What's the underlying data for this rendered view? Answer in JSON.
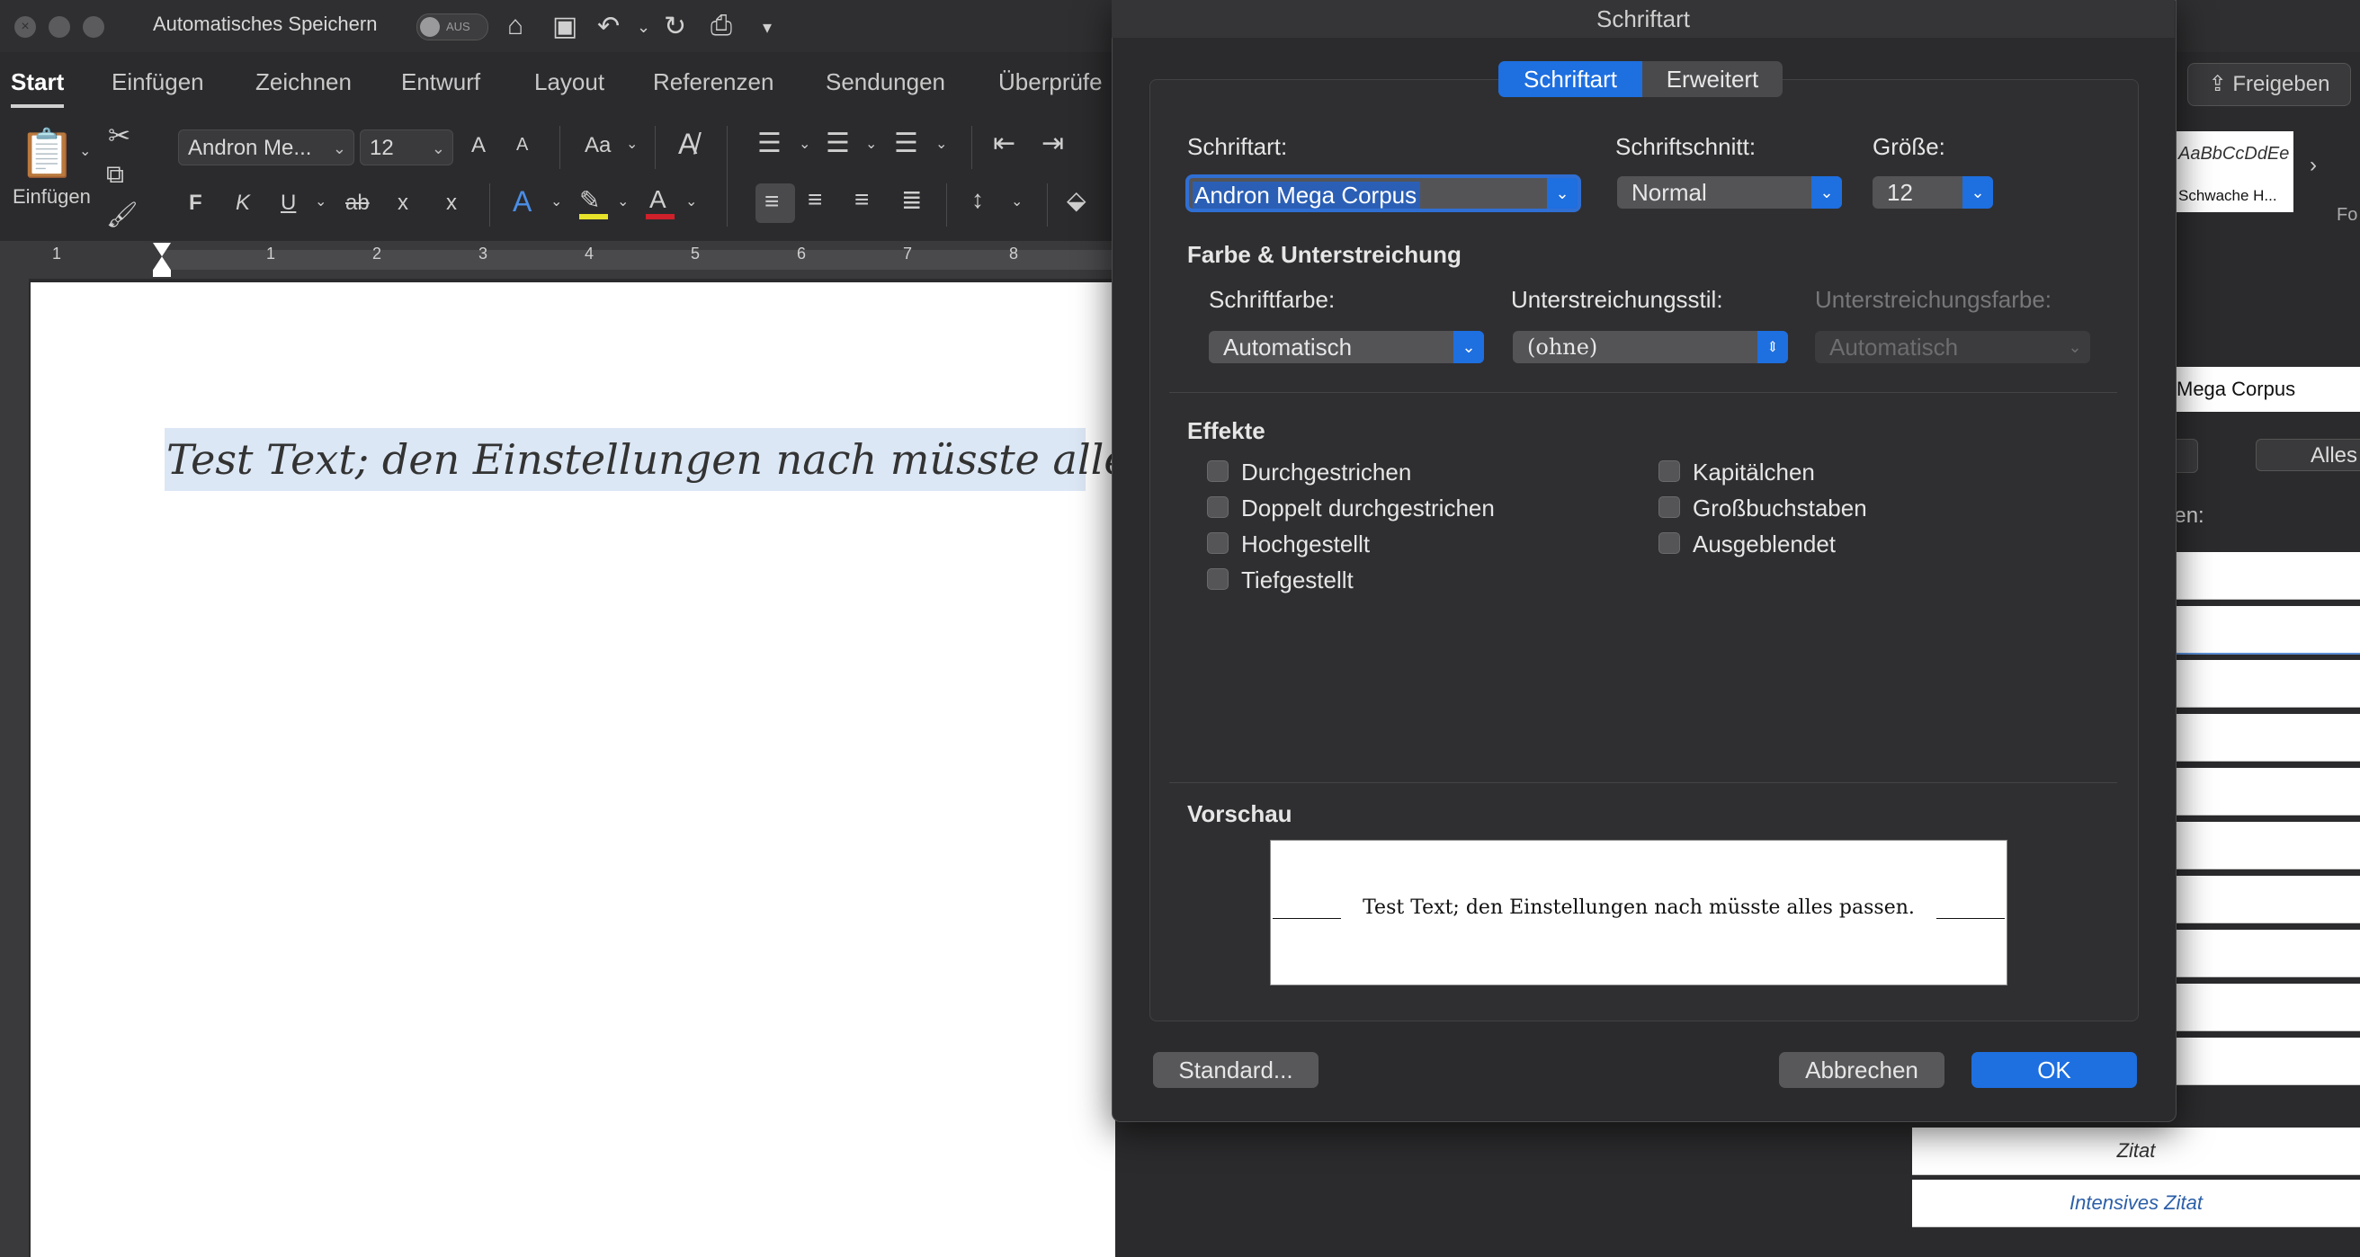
{
  "titlebar": {
    "autosave_label": "Automatisches Speichern",
    "autosave_state": "AUS"
  },
  "tabs": [
    "Start",
    "Einfügen",
    "Zeichnen",
    "Entwurf",
    "Layout",
    "Referenzen",
    "Sendungen",
    "Überprüfe"
  ],
  "ribbon": {
    "paste_label": "Einfügen",
    "font_name": "Andron Me...",
    "font_size": "12",
    "bold": "F",
    "italic": "K",
    "underline": "U",
    "strike": "ab",
    "sub": "x",
    "sup": "x",
    "grow": "A",
    "shrink": "A",
    "case": "Aa",
    "texteffect": "A",
    "fontcolor": "A",
    "ruler_numbers": [
      "1",
      "1",
      "2",
      "3",
      "4",
      "5",
      "6",
      "7",
      "8"
    ]
  },
  "document": {
    "text": "Test Text; den Einstellungen nach müsste alles passen.",
    "pilcrow": "¶"
  },
  "right_pane": {
    "share_label": "Freigeben",
    "gallery_sample": "AaBbCcDdEe",
    "gallery_name": "Schwache H...",
    "gallery_more": "Fo",
    "font_field": "Mega Corpus",
    "button_label": "Alles",
    "section_label": "nen:",
    "style_zitat": "Zitat",
    "style_intensiv": "Intensives Zitat"
  },
  "dialog": {
    "title": "Schriftart",
    "tabs": [
      "Schriftart",
      "Erweitert"
    ],
    "font_label": "Schriftart:",
    "font_value": "Andron Mega Corpus",
    "style_label": "Schriftschnitt:",
    "style_value": "Normal",
    "size_label": "Größe:",
    "size_value": "12",
    "color_section": "Farbe & Unterstreichung",
    "font_color_label": "Schriftfarbe:",
    "font_color_value": "Automatisch",
    "underline_style_label": "Unterstreichungsstil:",
    "underline_style_value": "(ohne)",
    "underline_color_label": "Unterstreichungsfarbe:",
    "underline_color_value": "Automatisch",
    "effects_section": "Effekte",
    "effects_left": [
      "Durchgestrichen",
      "Doppelt durchgestrichen",
      "Hochgestellt",
      "Tiefgestellt"
    ],
    "effects_right": [
      "Kapitälchen",
      "Großbuchstaben",
      "Ausgeblendet"
    ],
    "preview_section": "Vorschau",
    "preview_text": "Test Text; den Einstellungen nach müsste alles passen.",
    "btn_default": "Standard...",
    "btn_cancel": "Abbrechen",
    "btn_ok": "OK"
  },
  "colors": {
    "accent": "#1e6fe0",
    "selection": "#dce7f5"
  }
}
